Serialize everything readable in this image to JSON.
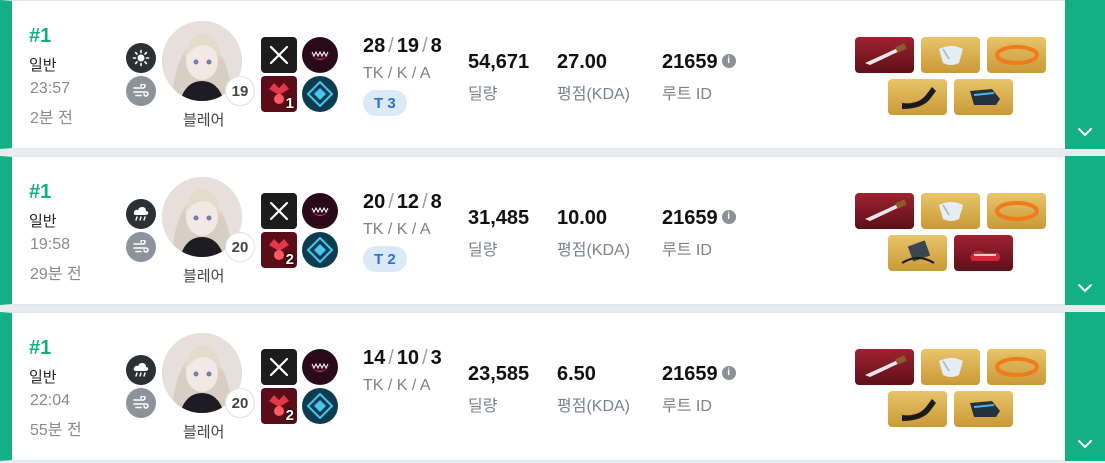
{
  "matches": [
    {
      "rank": "#1",
      "mode": "일반",
      "time": "23:57",
      "ago": "2분 전",
      "weather_main": "sun-icon",
      "weather_sub": "wind-icon",
      "character": "블레어",
      "level": "19",
      "trait_level": "1",
      "kills": "28",
      "deaths": "19",
      "assists": "8",
      "kda_label": "TK / K / A",
      "tier": "T 3",
      "damage": "54,671",
      "damage_label": "딜량",
      "score": "27.00",
      "score_label": "평점(KDA)",
      "route": "21659",
      "route_label": "루트 ID",
      "items": [
        "red",
        "gold",
        "gold",
        "gold",
        "gold"
      ]
    },
    {
      "rank": "#1",
      "mode": "일반",
      "time": "19:58",
      "ago": "29분 전",
      "weather_main": "cloud-rain-icon",
      "weather_sub": "wind-icon",
      "character": "블레어",
      "level": "20",
      "trait_level": "2",
      "kills": "20",
      "deaths": "12",
      "assists": "8",
      "kda_label": "TK / K / A",
      "tier": "T 2",
      "damage": "31,485",
      "damage_label": "딜량",
      "score": "10.00",
      "score_label": "평점(KDA)",
      "route": "21659",
      "route_label": "루트 ID",
      "items": [
        "red",
        "gold",
        "gold",
        "gold",
        "red"
      ]
    },
    {
      "rank": "#1",
      "mode": "일반",
      "time": "22:04",
      "ago": "55분 전",
      "weather_main": "cloud-rain-icon",
      "weather_sub": "wind-icon",
      "character": "블레어",
      "level": "20",
      "trait_level": "2",
      "kills": "14",
      "deaths": "10",
      "assists": "3",
      "kda_label": "TK / K / A",
      "tier": "",
      "damage": "23,585",
      "damage_label": "딜량",
      "score": "6.50",
      "score_label": "평점(KDA)",
      "route": "21659",
      "route_label": "루트 ID",
      "items": [
        "red",
        "gold",
        "gold",
        "gold",
        "gold"
      ]
    }
  ],
  "colors": {
    "accent": "#13b085",
    "tier_bg": "#dbe9f9",
    "tier_text": "#2a6fd1"
  }
}
